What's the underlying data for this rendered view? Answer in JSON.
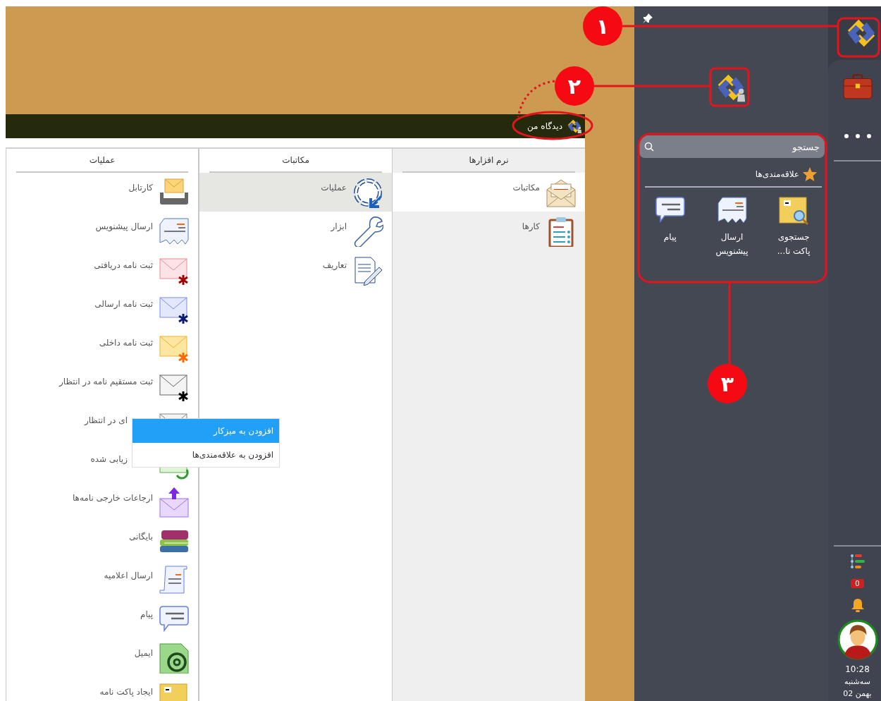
{
  "view_bar": {
    "label": "دیدگاه من"
  },
  "columns": [
    {
      "heading": "نرم افزارها",
      "items": [
        {
          "label": "مکاتبات",
          "selected": true
        },
        {
          "label": "کارها",
          "selected": false
        }
      ]
    },
    {
      "heading": "مکاتبات",
      "items": [
        {
          "label": "عملیات",
          "selected": true
        },
        {
          "label": "ابزار",
          "selected": false
        },
        {
          "label": "تعاریف",
          "selected": false
        }
      ]
    },
    {
      "heading": "عملیات",
      "items": [
        {
          "label": "کارتابل",
          "selected": false
        },
        {
          "label": "ارسال پیشنویس",
          "selected": false
        },
        {
          "label": "ثبت نامه دریافتی",
          "selected": false
        },
        {
          "label": "ثبت نامه ارسالی",
          "selected": false
        },
        {
          "label": "ثبت نامه داخلی",
          "selected": false
        },
        {
          "label": "ثبت مستقیم نامه در انتظار",
          "selected": false
        },
        {
          "label": "ای در انتظار",
          "selected": false
        },
        {
          "label": "زیابی شده",
          "selected": false
        },
        {
          "label": "ارجاعات خارجی نامه‌ها",
          "selected": false
        },
        {
          "label": "بایگانی",
          "selected": false
        },
        {
          "label": "ارسال اعلامیه",
          "selected": false
        },
        {
          "label": "پیام",
          "selected": false
        },
        {
          "label": "ایمیل",
          "selected": false
        },
        {
          "label": "ایجاد پاکت نامه",
          "selected": false
        }
      ]
    }
  ],
  "context_menu": {
    "items": [
      {
        "label": "افزودن به میزکار",
        "selected": true
      },
      {
        "label": "افزودن به علاقه‌مندی‌ها",
        "selected": false
      }
    ]
  },
  "search": {
    "placeholder": "جستجو"
  },
  "favorites": {
    "title": "علاقه‌مندی‌ها",
    "items": [
      {
        "label": "جستجوی پاکت نا..."
      },
      {
        "label": "ارسال پیشنویس"
      },
      {
        "label": "پیام"
      }
    ]
  },
  "sidebar": {
    "notification_count": "0",
    "time": "10:28",
    "day": "سه‌شنبه",
    "date": "02 بهمن"
  },
  "callouts": [
    {
      "number": "۱"
    },
    {
      "number": "۲"
    },
    {
      "number": "۳"
    }
  ]
}
